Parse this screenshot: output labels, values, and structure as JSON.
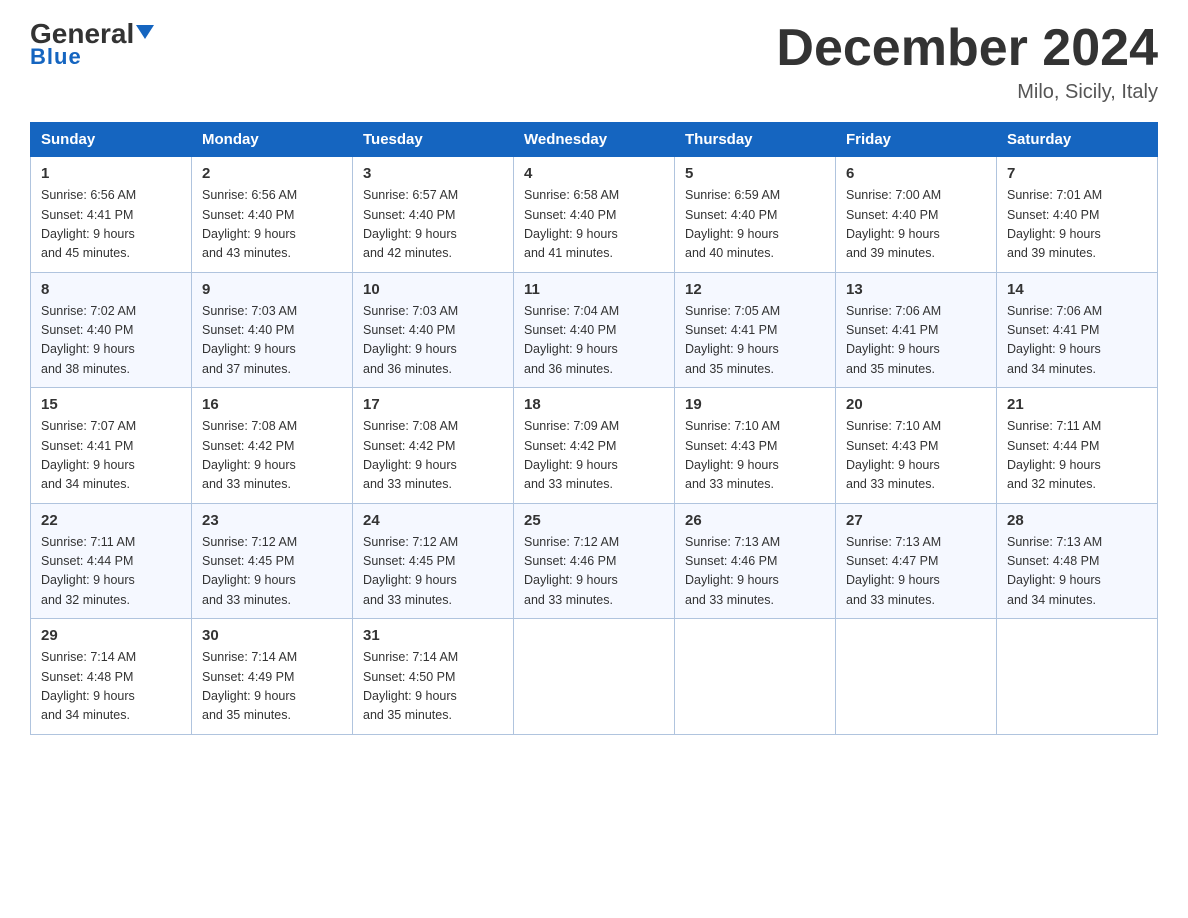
{
  "header": {
    "logo_general": "General",
    "logo_blue": "Blue",
    "month_title": "December 2024",
    "location": "Milo, Sicily, Italy"
  },
  "weekdays": [
    "Sunday",
    "Monday",
    "Tuesday",
    "Wednesday",
    "Thursday",
    "Friday",
    "Saturday"
  ],
  "weeks": [
    [
      {
        "day": "1",
        "sunrise": "6:56 AM",
        "sunset": "4:41 PM",
        "daylight": "9 hours and 45 minutes."
      },
      {
        "day": "2",
        "sunrise": "6:56 AM",
        "sunset": "4:40 PM",
        "daylight": "9 hours and 43 minutes."
      },
      {
        "day": "3",
        "sunrise": "6:57 AM",
        "sunset": "4:40 PM",
        "daylight": "9 hours and 42 minutes."
      },
      {
        "day": "4",
        "sunrise": "6:58 AM",
        "sunset": "4:40 PM",
        "daylight": "9 hours and 41 minutes."
      },
      {
        "day": "5",
        "sunrise": "6:59 AM",
        "sunset": "4:40 PM",
        "daylight": "9 hours and 40 minutes."
      },
      {
        "day": "6",
        "sunrise": "7:00 AM",
        "sunset": "4:40 PM",
        "daylight": "9 hours and 39 minutes."
      },
      {
        "day": "7",
        "sunrise": "7:01 AM",
        "sunset": "4:40 PM",
        "daylight": "9 hours and 39 minutes."
      }
    ],
    [
      {
        "day": "8",
        "sunrise": "7:02 AM",
        "sunset": "4:40 PM",
        "daylight": "9 hours and 38 minutes."
      },
      {
        "day": "9",
        "sunrise": "7:03 AM",
        "sunset": "4:40 PM",
        "daylight": "9 hours and 37 minutes."
      },
      {
        "day": "10",
        "sunrise": "7:03 AM",
        "sunset": "4:40 PM",
        "daylight": "9 hours and 36 minutes."
      },
      {
        "day": "11",
        "sunrise": "7:04 AM",
        "sunset": "4:40 PM",
        "daylight": "9 hours and 36 minutes."
      },
      {
        "day": "12",
        "sunrise": "7:05 AM",
        "sunset": "4:41 PM",
        "daylight": "9 hours and 35 minutes."
      },
      {
        "day": "13",
        "sunrise": "7:06 AM",
        "sunset": "4:41 PM",
        "daylight": "9 hours and 35 minutes."
      },
      {
        "day": "14",
        "sunrise": "7:06 AM",
        "sunset": "4:41 PM",
        "daylight": "9 hours and 34 minutes."
      }
    ],
    [
      {
        "day": "15",
        "sunrise": "7:07 AM",
        "sunset": "4:41 PM",
        "daylight": "9 hours and 34 minutes."
      },
      {
        "day": "16",
        "sunrise": "7:08 AM",
        "sunset": "4:42 PM",
        "daylight": "9 hours and 33 minutes."
      },
      {
        "day": "17",
        "sunrise": "7:08 AM",
        "sunset": "4:42 PM",
        "daylight": "9 hours and 33 minutes."
      },
      {
        "day": "18",
        "sunrise": "7:09 AM",
        "sunset": "4:42 PM",
        "daylight": "9 hours and 33 minutes."
      },
      {
        "day": "19",
        "sunrise": "7:10 AM",
        "sunset": "4:43 PM",
        "daylight": "9 hours and 33 minutes."
      },
      {
        "day": "20",
        "sunrise": "7:10 AM",
        "sunset": "4:43 PM",
        "daylight": "9 hours and 33 minutes."
      },
      {
        "day": "21",
        "sunrise": "7:11 AM",
        "sunset": "4:44 PM",
        "daylight": "9 hours and 32 minutes."
      }
    ],
    [
      {
        "day": "22",
        "sunrise": "7:11 AM",
        "sunset": "4:44 PM",
        "daylight": "9 hours and 32 minutes."
      },
      {
        "day": "23",
        "sunrise": "7:12 AM",
        "sunset": "4:45 PM",
        "daylight": "9 hours and 33 minutes."
      },
      {
        "day": "24",
        "sunrise": "7:12 AM",
        "sunset": "4:45 PM",
        "daylight": "9 hours and 33 minutes."
      },
      {
        "day": "25",
        "sunrise": "7:12 AM",
        "sunset": "4:46 PM",
        "daylight": "9 hours and 33 minutes."
      },
      {
        "day": "26",
        "sunrise": "7:13 AM",
        "sunset": "4:46 PM",
        "daylight": "9 hours and 33 minutes."
      },
      {
        "day": "27",
        "sunrise": "7:13 AM",
        "sunset": "4:47 PM",
        "daylight": "9 hours and 33 minutes."
      },
      {
        "day": "28",
        "sunrise": "7:13 AM",
        "sunset": "4:48 PM",
        "daylight": "9 hours and 34 minutes."
      }
    ],
    [
      {
        "day": "29",
        "sunrise": "7:14 AM",
        "sunset": "4:48 PM",
        "daylight": "9 hours and 34 minutes."
      },
      {
        "day": "30",
        "sunrise": "7:14 AM",
        "sunset": "4:49 PM",
        "daylight": "9 hours and 35 minutes."
      },
      {
        "day": "31",
        "sunrise": "7:14 AM",
        "sunset": "4:50 PM",
        "daylight": "9 hours and 35 minutes."
      },
      null,
      null,
      null,
      null
    ]
  ]
}
